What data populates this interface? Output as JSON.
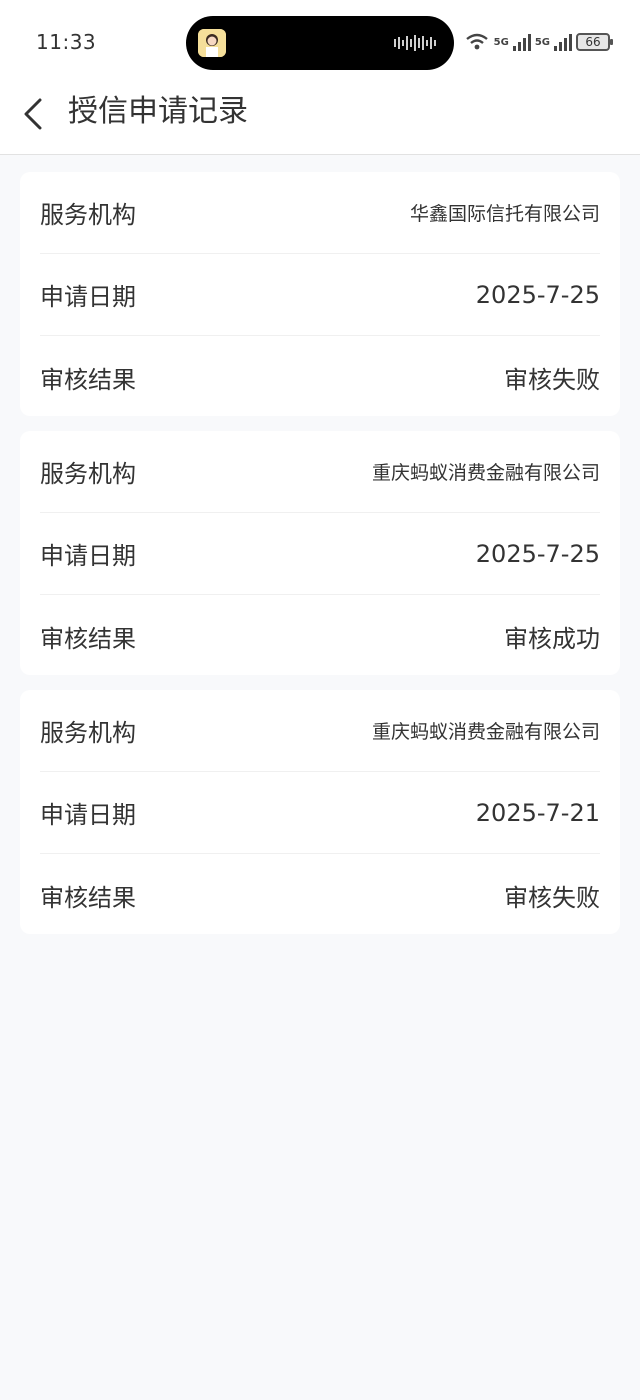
{
  "status_bar": {
    "time": "11:33",
    "network_1": "5G",
    "network_2": "5G",
    "battery": "66"
  },
  "header": {
    "title": "授信申请记录"
  },
  "records": [
    {
      "institution_label": "服务机构",
      "institution": "华鑫国际信托有限公司",
      "date_label": "申请日期",
      "date": "2025-7-25",
      "result_label": "审核结果",
      "result": "审核失败"
    },
    {
      "institution_label": "服务机构",
      "institution": "重庆蚂蚁消费金融有限公司",
      "date_label": "申请日期",
      "date": "2025-7-25",
      "result_label": "审核结果",
      "result": "审核成功"
    },
    {
      "institution_label": "服务机构",
      "institution": "重庆蚂蚁消费金融有限公司",
      "date_label": "申请日期",
      "date": "2025-7-21",
      "result_label": "审核结果",
      "result": "审核失败"
    }
  ]
}
